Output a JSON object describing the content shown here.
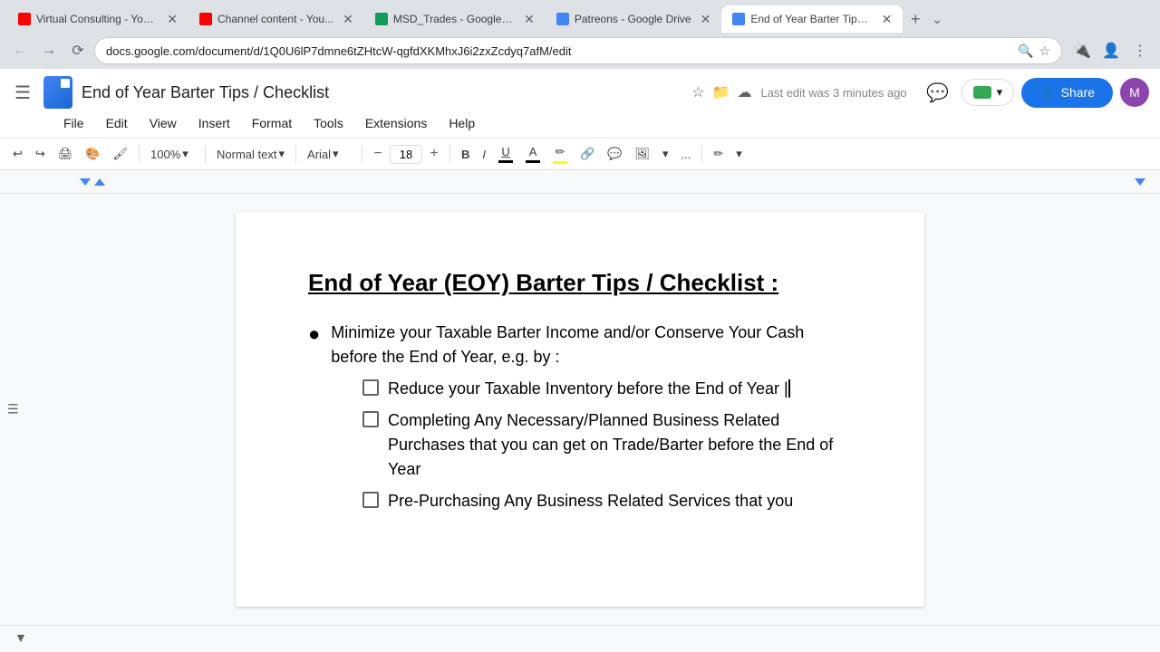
{
  "browser": {
    "tabs": [
      {
        "id": "tab1",
        "label": "Virtual Consulting - You...",
        "favicon": "yt",
        "active": false
      },
      {
        "id": "tab2",
        "label": "Channel content - You...",
        "favicon": "yt",
        "active": false
      },
      {
        "id": "tab3",
        "label": "MSD_Trades - Google S...",
        "favicon": "gs",
        "active": false
      },
      {
        "id": "tab4",
        "label": "Patreons - Google Drive",
        "favicon": "gd",
        "active": false
      },
      {
        "id": "tab5",
        "label": "End of Year Barter Tips ...",
        "favicon": "gdoc",
        "active": true
      }
    ],
    "address": "docs.google.com/document/d/1Q0U6lP7dmne6tZHtcW-qgfdXKMhxJ6i2zxZcdyq7afM/edit",
    "new_tab_symbol": "+"
  },
  "docs": {
    "title": "End of Year Barter Tips / Checklist",
    "last_edit": "Last edit was 3 minutes ago",
    "share_label": "Share",
    "menu": [
      "File",
      "Edit",
      "View",
      "Insert",
      "Format",
      "Tools",
      "Extensions",
      "Help"
    ],
    "toolbar": {
      "zoom": "100%",
      "style": "Normal text",
      "font": "Arial",
      "font_size": "18",
      "bold": "B",
      "italic": "I",
      "underline": "U",
      "more": "..."
    },
    "document": {
      "heading": "End of Year (EOY) Barter Tips / Checklist :",
      "bullet1_text": "Minimize your Taxable Barter Income and/or Conserve Your Cash before the End of Year, e.g. by :",
      "checklist": [
        {
          "text": "Reduce your Taxable Inventory before the End of Year |",
          "cursor": true
        },
        {
          "text": "Completing Any Necessary/Planned Business Related Purchases that you can get on Trade/Barter before the End of Year",
          "cursor": false
        },
        {
          "text": "Pre-Purchasing Any Business Related Services that you",
          "cursor": false
        }
      ]
    }
  }
}
